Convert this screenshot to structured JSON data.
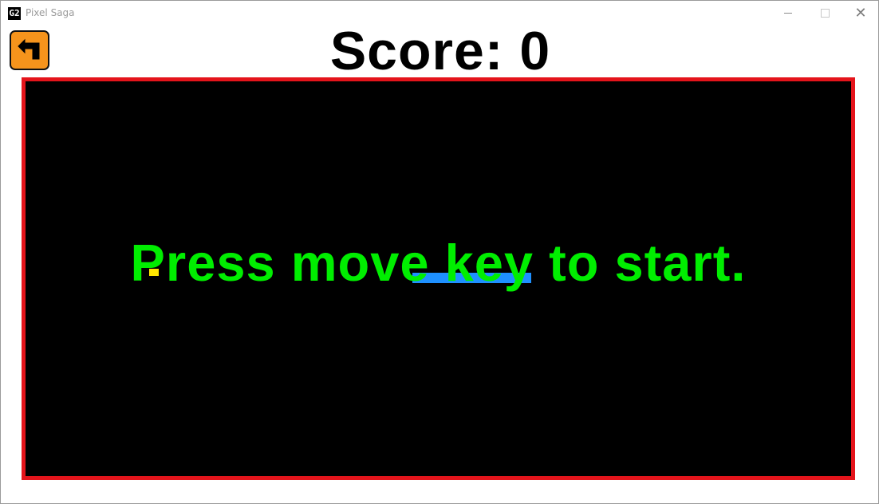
{
  "window": {
    "app_icon_text": "G2",
    "title": "Pixel Saga",
    "controls": {
      "minimize": "minimize-icon",
      "maximize": "maximize-icon",
      "close": "close-icon"
    }
  },
  "header": {
    "back_button_icon": "back-arrow-icon",
    "score_label": "Score:",
    "score_value": "0"
  },
  "game": {
    "prompt": "Press move key to start.",
    "colors": {
      "border": "#e4141b",
      "background": "#000000",
      "snake": "#1e90ff",
      "food": "#ffe600",
      "prompt": "#00ee00",
      "back_button": "#f6941c"
    }
  }
}
